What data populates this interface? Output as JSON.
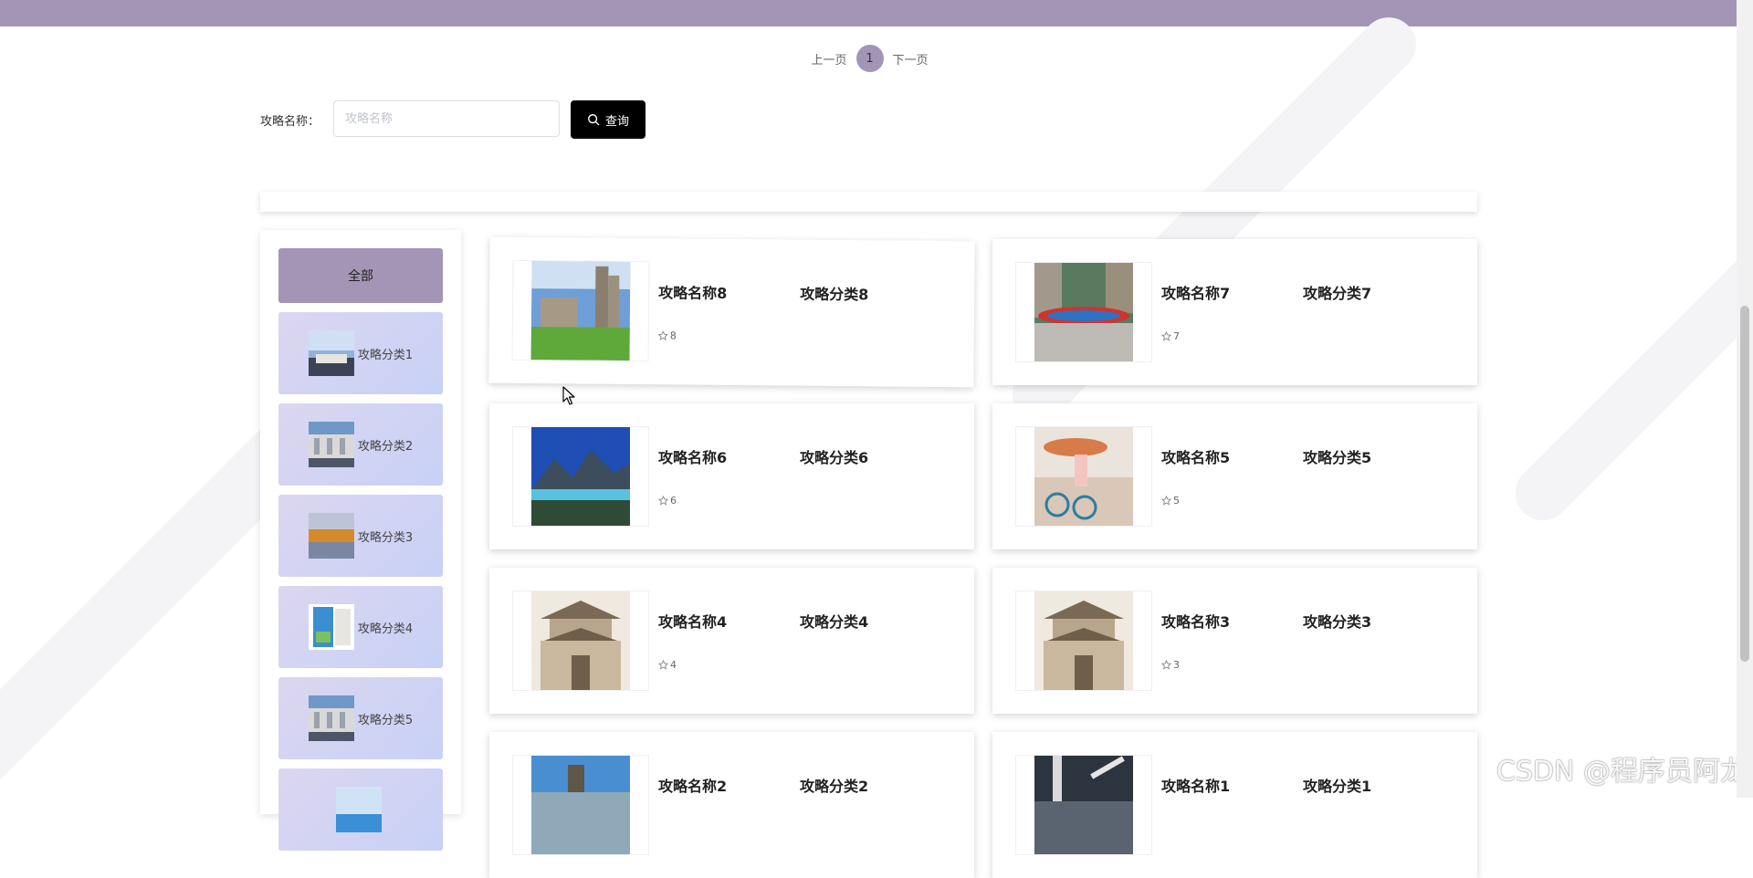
{
  "pagination": {
    "prev": "上一页",
    "current": "1",
    "next": "下一页"
  },
  "search": {
    "label": "攻略名称：",
    "placeholder": "攻略名称",
    "value": "",
    "button_label": "查询"
  },
  "sidebar": {
    "all_label": "全部",
    "categories": [
      {
        "label": "攻略分类1"
      },
      {
        "label": "攻略分类2"
      },
      {
        "label": "攻略分类3"
      },
      {
        "label": "攻略分类4"
      },
      {
        "label": "攻略分类5"
      },
      {
        "label": ""
      }
    ]
  },
  "cards": [
    {
      "name": "攻略名称8",
      "category": "攻略分类8",
      "stars": "8"
    },
    {
      "name": "攻略名称7",
      "category": "攻略分类7",
      "stars": "7"
    },
    {
      "name": "攻略名称6",
      "category": "攻略分类6",
      "stars": "6"
    },
    {
      "name": "攻略名称5",
      "category": "攻略分类5",
      "stars": "5"
    },
    {
      "name": "攻略名称4",
      "category": "攻略分类4",
      "stars": "4"
    },
    {
      "name": "攻略名称3",
      "category": "攻略分类3",
      "stars": "3"
    },
    {
      "name": "攻略名称2",
      "category": "攻略分类2",
      "stars": ""
    },
    {
      "name": "攻略名称1",
      "category": "攻略分类1",
      "stars": ""
    }
  ],
  "watermark": "CSDN @程序员阿龙",
  "colors": {
    "accent": "#a295b6",
    "button": "#000000",
    "category_bg_start": "#dcd6f0",
    "category_bg_end": "#c7d1f6"
  }
}
